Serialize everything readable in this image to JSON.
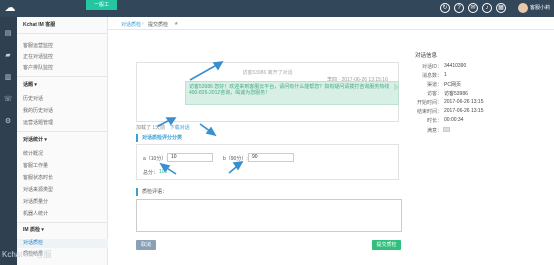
{
  "topbar": {
    "tab_label": "一般工",
    "user_name": "客服小莉",
    "icons": [
      "refresh-icon",
      "help-icon",
      "mail-icon",
      "bell-icon",
      "grid-icon"
    ]
  },
  "rail": {
    "icons": [
      "chart-icon",
      "chat-icon",
      "book-icon",
      "phone-icon",
      "settings-icon"
    ]
  },
  "menu": {
    "app_title": "Kchat IM 客服",
    "sections": [
      {
        "header": "",
        "items": [
          "客服运营监控",
          "正在对话监控",
          "客户排队监控"
        ]
      },
      {
        "header": "话题 ▾",
        "items": [
          "历史对话",
          "我的历史对话",
          "运营话题管理"
        ]
      },
      {
        "header": "对话统计 ▾",
        "items": [
          "统计概况",
          "客服工作量",
          "客服状态时长",
          "对话来源类型",
          "对话质量分",
          "机器人统计"
        ]
      },
      {
        "header": "IM 质检 ▾",
        "items": [
          "对话质检",
          "质检结果"
        ]
      }
    ]
  },
  "breadcrumb": {
    "items": [
      "对话质检",
      "提交质检"
    ]
  },
  "chat": {
    "notice": "访客53986 离开了对话",
    "meta": "李四 · 2017-06-26 13:15:16",
    "message": "访客53986 您好！欢迎来到客服云平台，请问有什么能帮您？如有疑问请拨打咨询服务热线400-826-2012咨询，竭诚为您服务！"
  },
  "links": [
    "加载了 1天前",
    "下载对话"
  ],
  "rating": {
    "section_title": "对话质检评分分类",
    "field_a_label": "a（10分）:",
    "field_a_value": "10",
    "field_b_label": "b（90分）:",
    "field_b_value": "90",
    "score_label": "总分：",
    "score_value": "100"
  },
  "comment": {
    "section_title": "质检评语：",
    "value": ""
  },
  "buttons": {
    "cancel": "取消",
    "submit": "提交质检"
  },
  "info": {
    "title": "对话信息",
    "rows": [
      {
        "label": "对话ID：",
        "value": "34410390"
      },
      {
        "label": "消息数：",
        "value": "1"
      },
      {
        "label": "渠道：",
        "value": "PC网页"
      },
      {
        "label": "访客：",
        "value": "访客53986"
      },
      {
        "label": "开始时间：",
        "value": "2017-06-26 13:15"
      },
      {
        "label": "结束时间：",
        "value": "2017-06-26 13:15"
      },
      {
        "label": "时长：",
        "value": "00:00:34"
      },
      {
        "label": "满意：",
        "value": ""
      }
    ]
  },
  "watermark": "Kchat IM 客服",
  "colors": {
    "topbar": "#33475a",
    "accent": "#23c6a0",
    "link": "#3a9fd5",
    "submit": "#2ec07c",
    "cancel": "#8aa0b5"
  }
}
